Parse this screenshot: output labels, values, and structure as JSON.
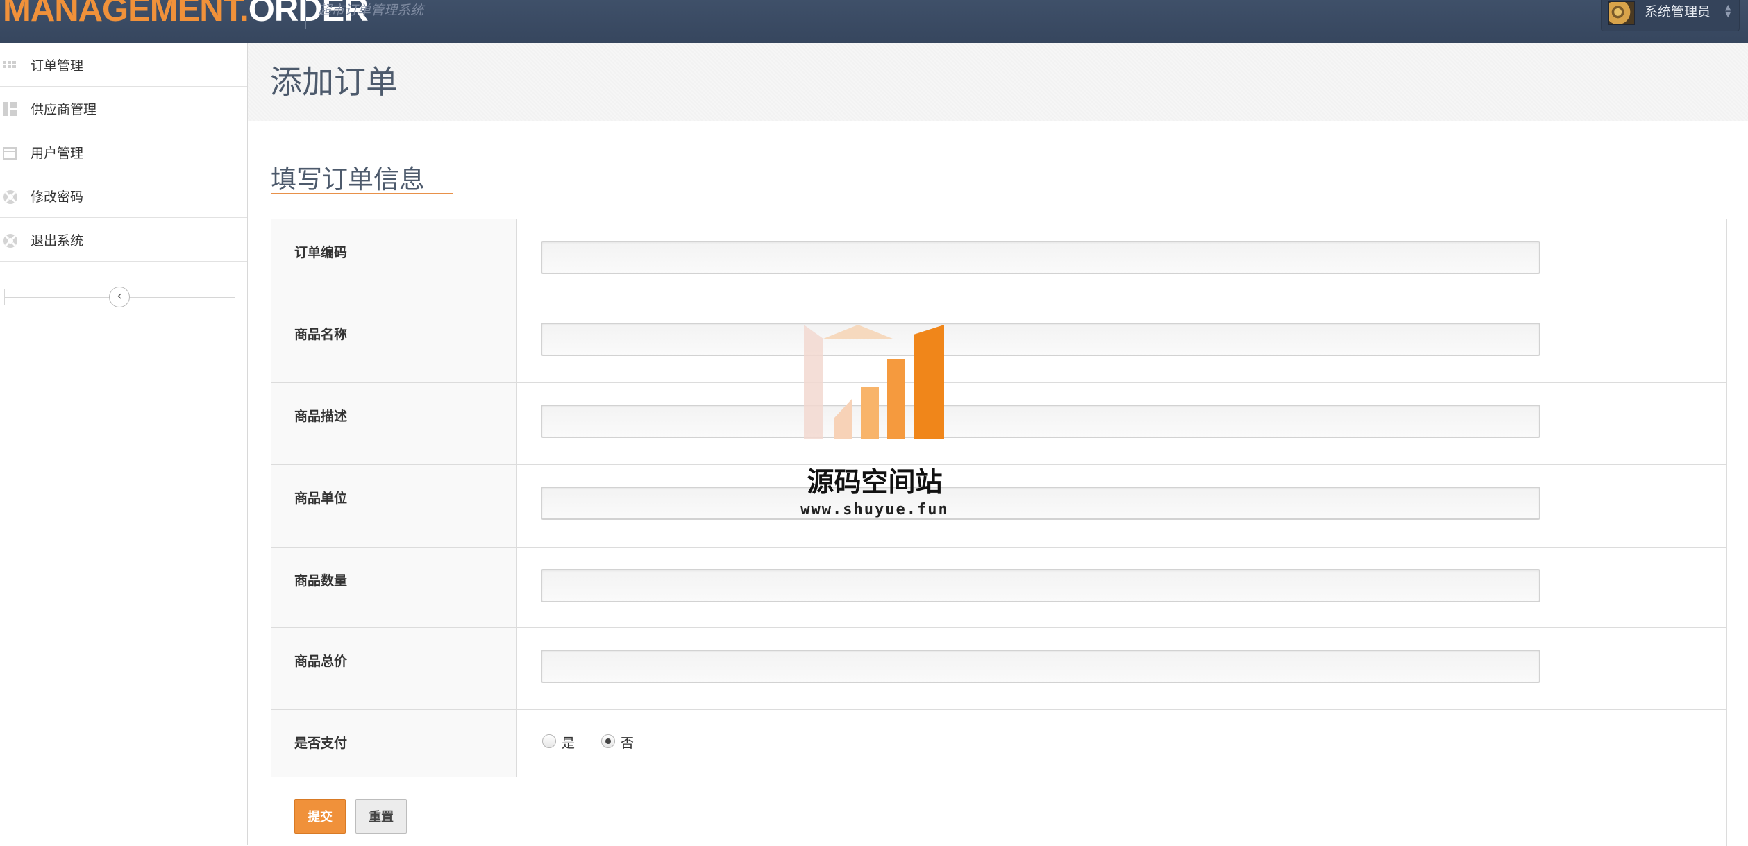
{
  "colors": {
    "topbar": "#3a4a63",
    "accent": "#f0913a",
    "sidebar_border": "#d8d8d8"
  },
  "header": {
    "brand_part1": "MANAGEMENT.",
    "brand_part2": "ORDER",
    "subtitle": "超市订单管理系统",
    "user_name": "系统管理员",
    "user_caret_icon": "updown-caret-icon"
  },
  "sidebar": {
    "items": [
      {
        "label": "订单管理",
        "icon": "grid-icon"
      },
      {
        "label": "供应商管理",
        "icon": "layout-icon"
      },
      {
        "label": "用户管理",
        "icon": "calendar-icon"
      },
      {
        "label": "修改密码",
        "icon": "lifebuoy-icon"
      },
      {
        "label": "退出系统",
        "icon": "lifebuoy-icon"
      }
    ],
    "collapse_icon": "chevron-left-icon"
  },
  "page": {
    "title": "添加订单",
    "section_title": "填写订单信息"
  },
  "form": {
    "fields": [
      {
        "label": "订单编码",
        "value": ""
      },
      {
        "label": "商品名称",
        "value": ""
      },
      {
        "label": "商品描述",
        "value": ""
      },
      {
        "label": "商品单位",
        "value": ""
      },
      {
        "label": "商品数量",
        "value": ""
      },
      {
        "label": "商品总价",
        "value": ""
      }
    ],
    "paid": {
      "label": "是否支付",
      "options": [
        "是",
        "否"
      ],
      "selected": "否"
    },
    "submit_label": "提交",
    "reset_label": "重置"
  },
  "watermark": {
    "text": "源码空间站",
    "url": "www.shuyue.fun"
  }
}
